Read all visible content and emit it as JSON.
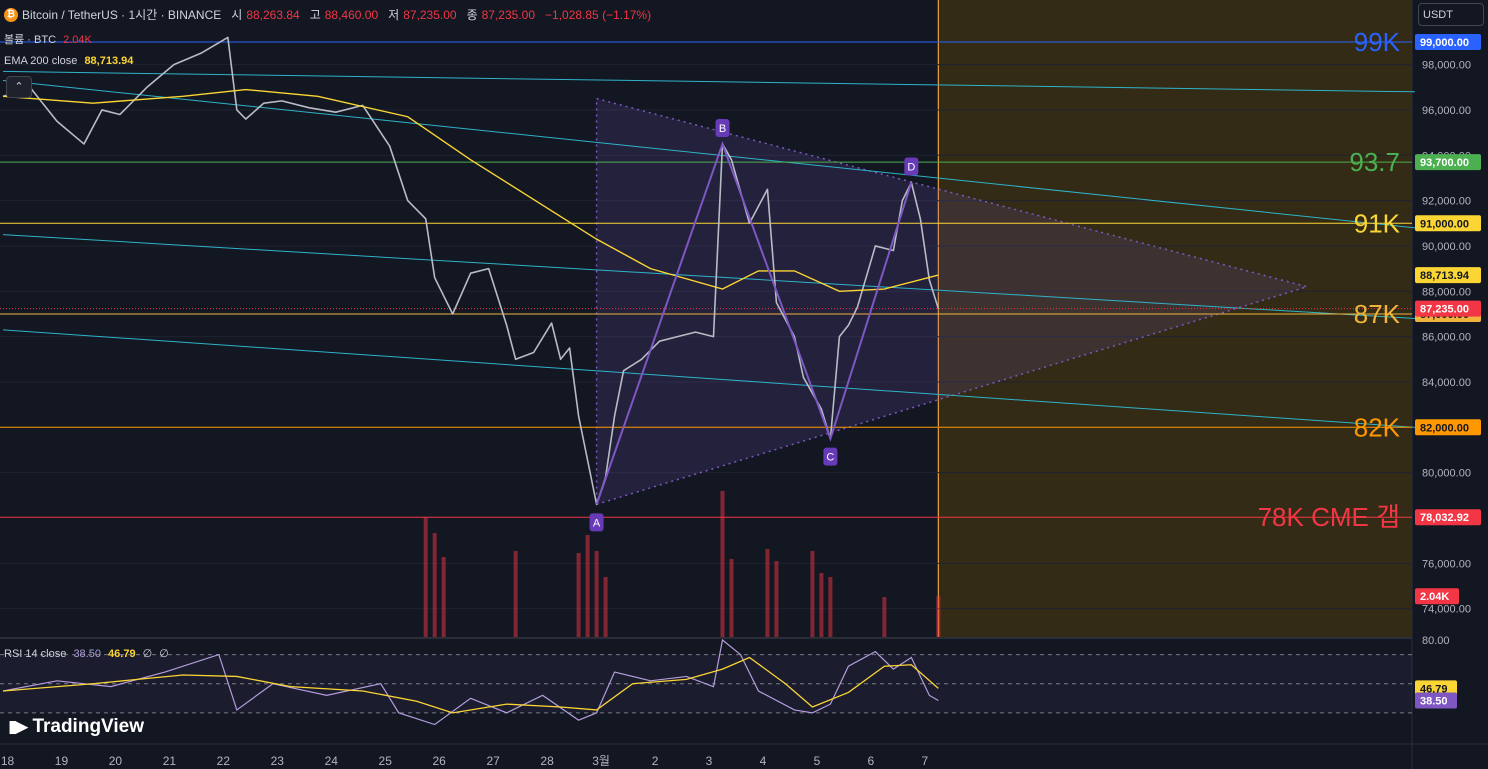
{
  "header": {
    "symbol": "Bitcoin / TetherUS · 1시간 · BINANCE",
    "open_label": "시",
    "open": "88,263.84",
    "high_label": "고",
    "high": "88,460.00",
    "low_label": "저",
    "low": "87,235.00",
    "close_label": "종",
    "close": "87,235.00",
    "change": "−1,028.85 (−1.17%)"
  },
  "volume_legend": {
    "label": "볼륨 · BTC",
    "value": "2.04K"
  },
  "ema_legend": {
    "label": "EMA 200 close",
    "value": "88,713.94"
  },
  "currency_button": "USDT",
  "rsi_legend": {
    "label": "RSI 14 close",
    "rsi": "38.50",
    "ma": "46.79",
    "extra1": "∅",
    "extra2": "∅"
  },
  "brand": "TradingView",
  "colors": {
    "background": "#131722",
    "up": "#26a69a",
    "down": "#f23645",
    "ema": "#fbd534",
    "channel": "#2fb3c9",
    "pattern": "#7e57c2",
    "future_zone": "#3a2f14",
    "level_99k": "#2962ff",
    "level_93_7k": "#4caf50",
    "level_91k": "#fbd534",
    "level_87k": "#f0b43c",
    "level_82k": "#ff9800",
    "level_78k": "#f23645",
    "rsi_line": "#b39ddb"
  },
  "chart_data": {
    "type": "line",
    "title": "Bitcoin / TetherUS · 1시간 · BINANCE",
    "price_axis": {
      "ylim": [
        72750,
        100850
      ],
      "ticks": [
        "98,000.00",
        "96,000.00",
        "94,000.00",
        "92,000.00",
        "90,000.00",
        "88,000.00",
        "86,000.00",
        "84,000.00",
        "82,000.00",
        "80,000.00",
        "76,000.00",
        "74,000.00"
      ]
    },
    "x_axis": {
      "labels": [
        {
          "label": "18",
          "slot": 0.5
        },
        {
          "label": "19",
          "slot": 6.5
        },
        {
          "label": "20",
          "slot": 12.5
        },
        {
          "label": "21",
          "slot": 18.5
        },
        {
          "label": "22",
          "slot": 24.5
        },
        {
          "label": "23",
          "slot": 30.5
        },
        {
          "label": "24",
          "slot": 36.5
        },
        {
          "label": "25",
          "slot": 42.5
        },
        {
          "label": "26",
          "slot": 48.5
        },
        {
          "label": "27",
          "slot": 54.5
        },
        {
          "label": "28",
          "slot": 60.5
        },
        {
          "label": "3월",
          "slot": 66.5
        },
        {
          "label": "2",
          "slot": 72.5
        },
        {
          "label": "3",
          "slot": 78.5
        },
        {
          "label": "4",
          "slot": 84.5
        },
        {
          "label": "5",
          "slot": 90.5
        },
        {
          "label": "6",
          "slot": 96.5
        },
        {
          "label": "7",
          "slot": 102.5
        }
      ],
      "slots_visible": 157,
      "last_candle_slot": 104,
      "future_start_slot": 104
    },
    "price_path": [
      {
        "slot": 0,
        "price": 96600
      },
      {
        "slot": 3,
        "price": 97000
      },
      {
        "slot": 6,
        "price": 95500
      },
      {
        "slot": 9,
        "price": 94500
      },
      {
        "slot": 11,
        "price": 96000
      },
      {
        "slot": 13,
        "price": 95800
      },
      {
        "slot": 16,
        "price": 97000
      },
      {
        "slot": 19,
        "price": 98000
      },
      {
        "slot": 22,
        "price": 98500
      },
      {
        "slot": 25,
        "price": 99200
      },
      {
        "slot": 26,
        "price": 96000
      },
      {
        "slot": 27,
        "price": 95600
      },
      {
        "slot": 29,
        "price": 96300
      },
      {
        "slot": 31,
        "price": 96400
      },
      {
        "slot": 34,
        "price": 96100
      },
      {
        "slot": 37,
        "price": 95900
      },
      {
        "slot": 40,
        "price": 96200
      },
      {
        "slot": 43,
        "price": 94400
      },
      {
        "slot": 45,
        "price": 92000
      },
      {
        "slot": 47,
        "price": 91200
      },
      {
        "slot": 48,
        "price": 88600
      },
      {
        "slot": 50,
        "price": 87000
      },
      {
        "slot": 52,
        "price": 88800
      },
      {
        "slot": 54,
        "price": 89000
      },
      {
        "slot": 56,
        "price": 86500
      },
      {
        "slot": 57,
        "price": 85000
      },
      {
        "slot": 59,
        "price": 85300
      },
      {
        "slot": 61,
        "price": 86600
      },
      {
        "slot": 62,
        "price": 85000
      },
      {
        "slot": 63,
        "price": 85500
      },
      {
        "slot": 64,
        "price": 82500
      },
      {
        "slot": 66,
        "price": 78600
      },
      {
        "slot": 67,
        "price": 79800
      },
      {
        "slot": 68,
        "price": 82500
      },
      {
        "slot": 69,
        "price": 84500
      },
      {
        "slot": 71,
        "price": 85000
      },
      {
        "slot": 73,
        "price": 85800
      },
      {
        "slot": 75,
        "price": 86000
      },
      {
        "slot": 77,
        "price": 86200
      },
      {
        "slot": 79,
        "price": 86000
      },
      {
        "slot": 80,
        "price": 94500
      },
      {
        "slot": 81,
        "price": 93800
      },
      {
        "slot": 83,
        "price": 91000
      },
      {
        "slot": 85,
        "price": 92500
      },
      {
        "slot": 86,
        "price": 87500
      },
      {
        "slot": 88,
        "price": 86000
      },
      {
        "slot": 89,
        "price": 84200
      },
      {
        "slot": 91,
        "price": 82800
      },
      {
        "slot": 92,
        "price": 81500
      },
      {
        "slot": 93,
        "price": 86000
      },
      {
        "slot": 94,
        "price": 86500
      },
      {
        "slot": 95,
        "price": 87300
      },
      {
        "slot": 97,
        "price": 90000
      },
      {
        "slot": 99,
        "price": 89800
      },
      {
        "slot": 100,
        "price": 92000
      },
      {
        "slot": 101,
        "price": 92800
      },
      {
        "slot": 102,
        "price": 91200
      },
      {
        "slot": 103,
        "price": 88500
      },
      {
        "slot": 104,
        "price": 87235
      }
    ],
    "ema200": [
      {
        "slot": 0,
        "price": 96600
      },
      {
        "slot": 10,
        "price": 96300
      },
      {
        "slot": 20,
        "price": 96600
      },
      {
        "slot": 27,
        "price": 96900
      },
      {
        "slot": 35,
        "price": 96600
      },
      {
        "slot": 45,
        "price": 95700
      },
      {
        "slot": 52,
        "price": 93800
      },
      {
        "slot": 60,
        "price": 91800
      },
      {
        "slot": 66,
        "price": 90300
      },
      {
        "slot": 72,
        "price": 89000
      },
      {
        "slot": 80,
        "price": 88100
      },
      {
        "slot": 84,
        "price": 88900
      },
      {
        "slot": 88,
        "price": 88900
      },
      {
        "slot": 93,
        "price": 88000
      },
      {
        "slot": 98,
        "price": 88100
      },
      {
        "slot": 104,
        "price": 88714
      }
    ],
    "volume": {
      "max": 8000,
      "bars": [
        {
          "slot": 47,
          "value": 6000
        },
        {
          "slot": 48,
          "value": 5200
        },
        {
          "slot": 49,
          "value": 4000
        },
        {
          "slot": 57,
          "value": 4300
        },
        {
          "slot": 64,
          "value": 4200
        },
        {
          "slot": 65,
          "value": 5100
        },
        {
          "slot": 66,
          "value": 4300
        },
        {
          "slot": 67,
          "value": 3000
        },
        {
          "slot": 80,
          "value": 7300
        },
        {
          "slot": 81,
          "value": 3900
        },
        {
          "slot": 85,
          "value": 4400
        },
        {
          "slot": 86,
          "value": 3800
        },
        {
          "slot": 90,
          "value": 4300
        },
        {
          "slot": 91,
          "value": 3200
        },
        {
          "slot": 92,
          "value": 3000
        },
        {
          "slot": 98,
          "value": 2000
        },
        {
          "slot": 104,
          "value": 2040
        }
      ]
    },
    "levels": [
      {
        "name": "99K",
        "price": 99000,
        "axis_tag": "99,000.00",
        "color_key": "level_99k"
      },
      {
        "name": "93.7",
        "price": 93700,
        "axis_tag": "93,700.00",
        "color_key": "level_93_7k"
      },
      {
        "name": "91K",
        "price": 91000,
        "axis_tag": "91,000.00",
        "color_key": "level_91k"
      },
      {
        "name": "87K",
        "price": 87000,
        "axis_tag": "87,000.00",
        "color_key": "level_87k"
      },
      {
        "name": "82K",
        "price": 82000,
        "axis_tag": "82,000.00",
        "color_key": "level_82k"
      },
      {
        "name": "78K CME 갭",
        "price": 78032.92,
        "axis_tag": "78,032.92",
        "color_key": "level_78k"
      }
    ],
    "price_tags": [
      {
        "price": 88713.94,
        "text": "88,713.94",
        "type": "ema"
      },
      {
        "price": 87235,
        "text": "87,235.00",
        "type": "last"
      },
      {
        "price": 74550,
        "text": "2.04K",
        "type": "volume"
      }
    ],
    "channel_lines": [
      {
        "slots": [
          0,
          157
        ],
        "prices": [
          97700,
          96800
        ]
      },
      {
        "slots": [
          0,
          157
        ],
        "prices": [
          97300,
          90800
        ]
      },
      {
        "slots": [
          0,
          157
        ],
        "prices": [
          90500,
          86800
        ]
      },
      {
        "slots": [
          0,
          157
        ],
        "prices": [
          86300,
          82000
        ]
      }
    ],
    "pattern_points": [
      {
        "label": "A",
        "slot": 66,
        "price": 78600
      },
      {
        "label": "B",
        "slot": 80,
        "price": 94500
      },
      {
        "label": "C",
        "slot": 92,
        "price": 81500
      },
      {
        "label": "D",
        "slot": 101,
        "price": 92800
      }
    ],
    "triangle": {
      "top": {
        "slot": 66,
        "price": 96500
      },
      "bottom": {
        "slot": 66,
        "price": 78600
      },
      "apex": {
        "slot": 145,
        "price": 88200
      }
    },
    "rsi": {
      "ylim": [
        10,
        80
      ],
      "top_tick": "80.00",
      "bands": [
        70,
        30
      ],
      "mid": 50,
      "current_rsi": 38.5,
      "current_ma": 46.79,
      "rsi_path": [
        {
          "slot": 0,
          "v": 45
        },
        {
          "slot": 6,
          "v": 52
        },
        {
          "slot": 12,
          "v": 48
        },
        {
          "slot": 18,
          "v": 58
        },
        {
          "slot": 24,
          "v": 70
        },
        {
          "slot": 26,
          "v": 32
        },
        {
          "slot": 30,
          "v": 50
        },
        {
          "slot": 36,
          "v": 42
        },
        {
          "slot": 42,
          "v": 50
        },
        {
          "slot": 44,
          "v": 30
        },
        {
          "slot": 48,
          "v": 22
        },
        {
          "slot": 52,
          "v": 40
        },
        {
          "slot": 56,
          "v": 30
        },
        {
          "slot": 60,
          "v": 42
        },
        {
          "slot": 64,
          "v": 25
        },
        {
          "slot": 66,
          "v": 30
        },
        {
          "slot": 68,
          "v": 58
        },
        {
          "slot": 72,
          "v": 52
        },
        {
          "slot": 76,
          "v": 55
        },
        {
          "slot": 79,
          "v": 48
        },
        {
          "slot": 80,
          "v": 80
        },
        {
          "slot": 82,
          "v": 70
        },
        {
          "slot": 84,
          "v": 45
        },
        {
          "slot": 88,
          "v": 32
        },
        {
          "slot": 90,
          "v": 30
        },
        {
          "slot": 92,
          "v": 36
        },
        {
          "slot": 94,
          "v": 62
        },
        {
          "slot": 97,
          "v": 72
        },
        {
          "slot": 99,
          "v": 60
        },
        {
          "slot": 101,
          "v": 68
        },
        {
          "slot": 103,
          "v": 42
        },
        {
          "slot": 104,
          "v": 38.5
        }
      ],
      "ma_path": [
        {
          "slot": 0,
          "v": 45
        },
        {
          "slot": 10,
          "v": 50
        },
        {
          "slot": 20,
          "v": 56
        },
        {
          "slot": 26,
          "v": 55
        },
        {
          "slot": 32,
          "v": 48
        },
        {
          "slot": 40,
          "v": 45
        },
        {
          "slot": 46,
          "v": 38
        },
        {
          "slot": 50,
          "v": 30
        },
        {
          "slot": 56,
          "v": 36
        },
        {
          "slot": 62,
          "v": 34
        },
        {
          "slot": 66,
          "v": 32
        },
        {
          "slot": 70,
          "v": 50
        },
        {
          "slot": 76,
          "v": 53
        },
        {
          "slot": 80,
          "v": 60
        },
        {
          "slot": 83,
          "v": 68
        },
        {
          "slot": 87,
          "v": 50
        },
        {
          "slot": 90,
          "v": 34
        },
        {
          "slot": 94,
          "v": 44
        },
        {
          "slot": 98,
          "v": 62
        },
        {
          "slot": 101,
          "v": 63
        },
        {
          "slot": 104,
          "v": 46.79
        }
      ]
    }
  }
}
